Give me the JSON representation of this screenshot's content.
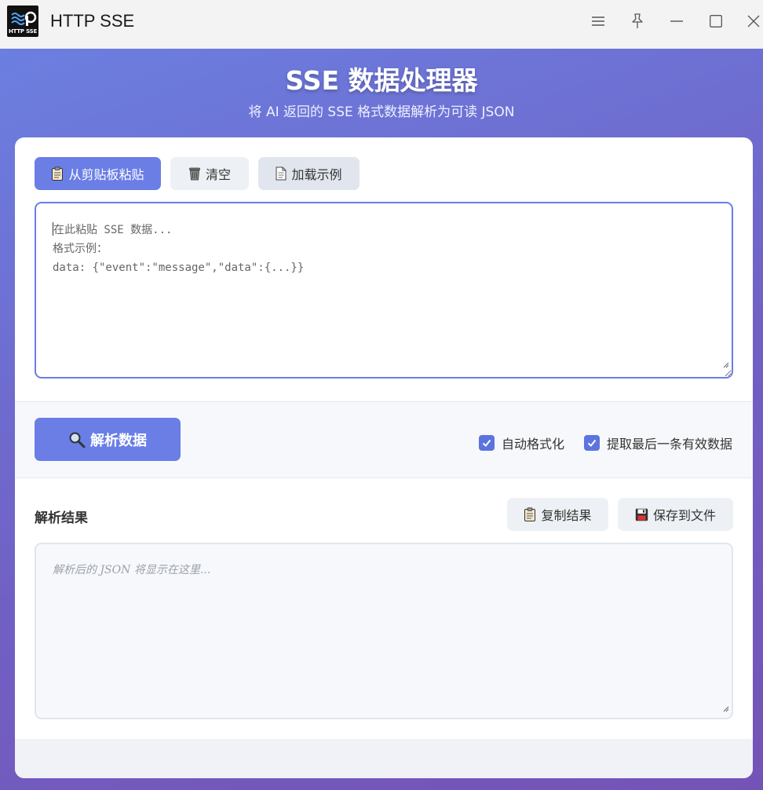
{
  "window": {
    "title": "HTTP SSE",
    "logo_text": "HTTP SSE"
  },
  "header": {
    "title": "SSE 数据处理器",
    "subtitle": "将 AI 返回的 SSE 格式数据解析为可读 JSON"
  },
  "toolbar": {
    "paste_label": "从剪贴板粘贴",
    "clear_label": "清空",
    "example_label": "加载示例"
  },
  "input": {
    "placeholder_lines": [
      "在此粘贴 SSE 数据...",
      "格式示例：",
      "data: {\"event\":\"message\",\"data\":{...}}"
    ]
  },
  "actions": {
    "parse_label": "解析数据",
    "auto_format_label": "自动格式化",
    "auto_format_checked": true,
    "extract_last_label": "提取最后一条有效数据",
    "extract_last_checked": true
  },
  "result": {
    "title": "解析结果",
    "copy_label": "复制结果",
    "save_label": "保存到文件",
    "placeholder": "解析后的 JSON 将显示在这里..."
  },
  "colors": {
    "accent": "#6a7ee6",
    "gradient_start": "#6b7fe0",
    "gradient_end": "#7453b6"
  },
  "icons": [
    "menu-icon",
    "pin-icon",
    "minimize-icon",
    "maximize-icon",
    "close-icon",
    "clipboard-icon",
    "trash-icon",
    "document-icon",
    "search-icon",
    "check-icon",
    "floppy-disk-icon"
  ]
}
